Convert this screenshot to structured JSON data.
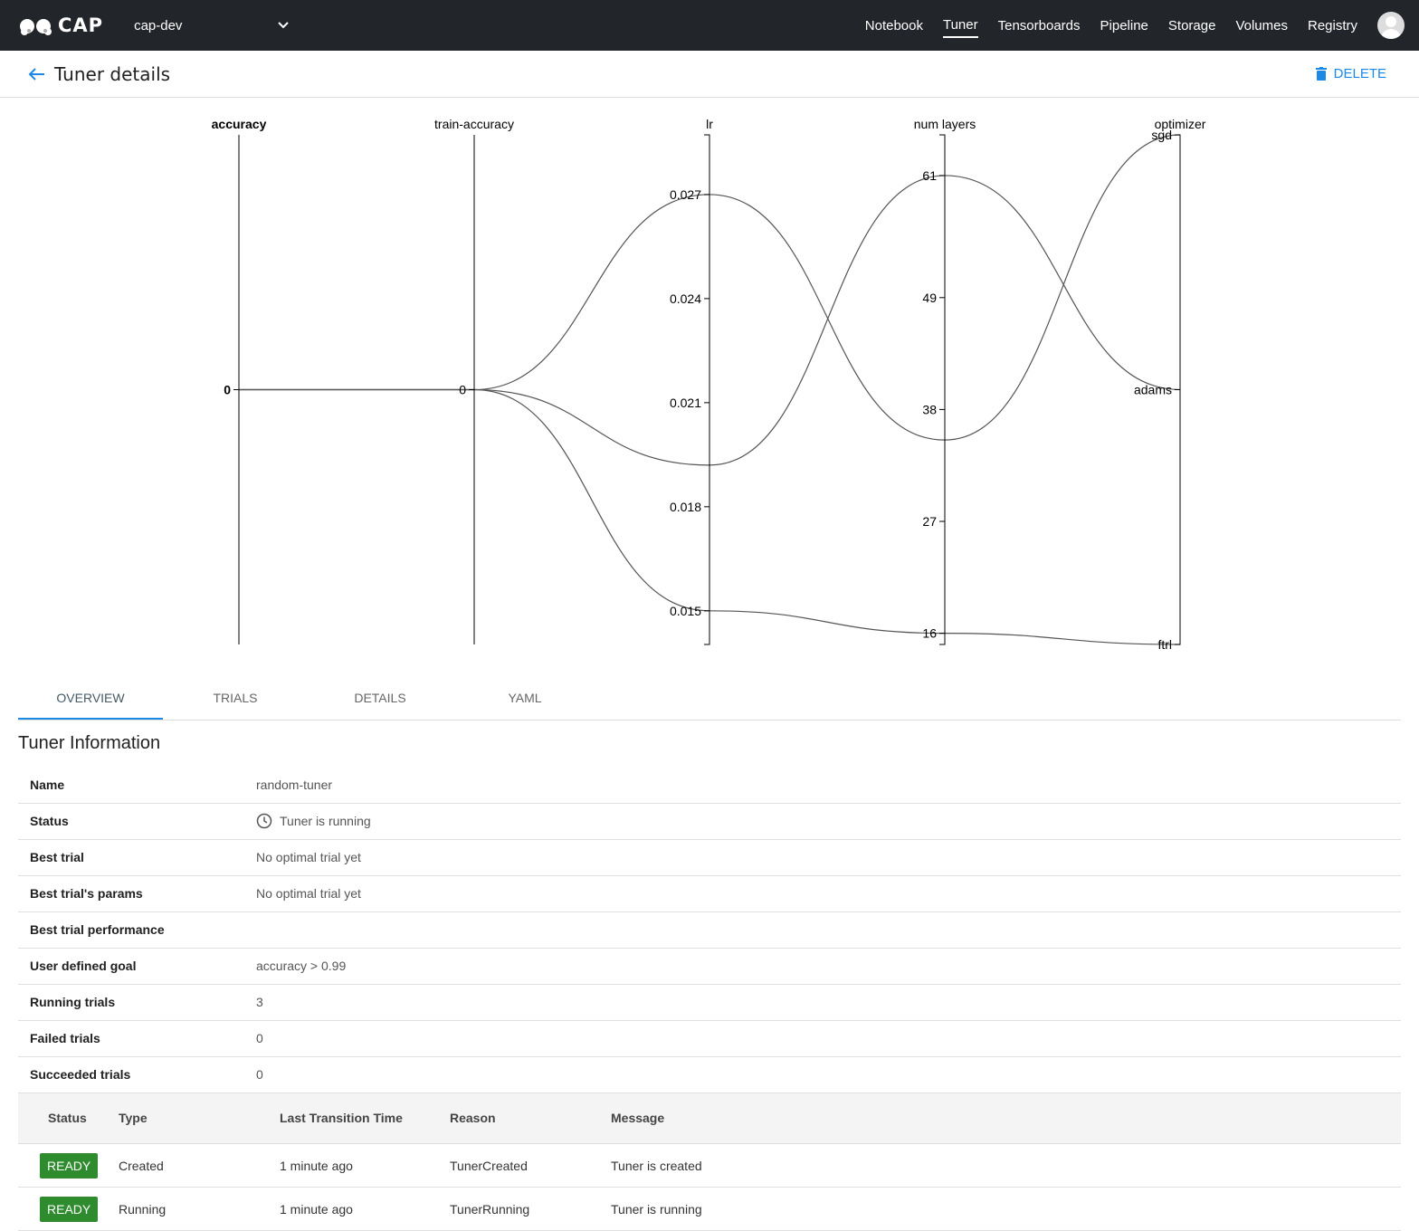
{
  "topbar": {
    "brand": "CAP",
    "namespace": "cap-dev",
    "nav": [
      "Notebook",
      "Tuner",
      "Tensorboards",
      "Pipeline",
      "Storage",
      "Volumes",
      "Registry"
    ],
    "active": "Tuner"
  },
  "header": {
    "title": "Tuner details",
    "delete_label": "DELETE",
    "accent": "#1e88e5"
  },
  "chart_data": {
    "type": "parallel-coordinates",
    "axes": [
      {
        "name": "accuracy",
        "type": "numeric",
        "ticks": [
          "0"
        ],
        "tick_values": [
          0
        ],
        "domain": [
          -1,
          1
        ]
      },
      {
        "name": "train-accuracy",
        "type": "numeric",
        "ticks": [
          "0"
        ],
        "tick_values": [
          0
        ],
        "domain": [
          -1,
          1
        ]
      },
      {
        "name": "lr",
        "type": "numeric",
        "ticks": [
          "0.027",
          "0.024",
          "0.021",
          "0.018",
          "0.015"
        ],
        "tick_values": [
          0.027,
          0.024,
          0.021,
          0.018,
          0.015
        ],
        "domain": [
          0.01403,
          0.02872
        ]
      },
      {
        "name": "num layers",
        "type": "numeric",
        "ticks": [
          "61",
          "49",
          "38",
          "27",
          "16"
        ],
        "tick_values": [
          61,
          49,
          38,
          27,
          16
        ],
        "domain": [
          14.9,
          65
        ]
      },
      {
        "name": "optimizer",
        "type": "categorical",
        "ticks": [
          "sgd",
          "adams",
          "ftrl"
        ]
      }
    ],
    "trials": [
      {
        "accuracy": 0,
        "train-accuracy": 0,
        "lr": 0.027,
        "num layers": 35,
        "optimizer": "sgd"
      },
      {
        "accuracy": 0,
        "train-accuracy": 0,
        "lr": 0.0192,
        "num layers": 61,
        "optimizer": "adams"
      },
      {
        "accuracy": 0,
        "train-accuracy": 0,
        "lr": 0.015,
        "num layers": 16,
        "optimizer": "ftrl"
      }
    ]
  },
  "tabs": [
    "OVERVIEW",
    "TRIALS",
    "DETAILS",
    "YAML"
  ],
  "info": {
    "title": "Tuner Information",
    "rows": [
      {
        "label": "Name",
        "value": "random-tuner"
      },
      {
        "label": "Status",
        "value": "Tuner is running"
      },
      {
        "label": "Best trial",
        "value": "No optimal trial yet"
      },
      {
        "label": "Best trial's params",
        "value": "No optimal trial yet"
      },
      {
        "label": "Best trial performance",
        "value": ""
      },
      {
        "label": "User defined goal",
        "value": "accuracy > 0.99"
      },
      {
        "label": "Running trials",
        "value": "3"
      },
      {
        "label": "Failed trials",
        "value": "0"
      },
      {
        "label": "Succeeded trials",
        "value": "0"
      }
    ]
  },
  "conditions": {
    "headers": [
      "Status",
      "Type",
      "Last Transition Time",
      "Reason",
      "Message"
    ],
    "rows": [
      {
        "status": "READY",
        "type": "Created",
        "time": "1 minute ago",
        "reason": "TunerCreated",
        "message": "Tuner is created"
      },
      {
        "status": "READY",
        "type": "Running",
        "time": "1 minute ago",
        "reason": "TunerRunning",
        "message": "Tuner is running"
      }
    ],
    "ready_color": "#2e8b2e"
  }
}
